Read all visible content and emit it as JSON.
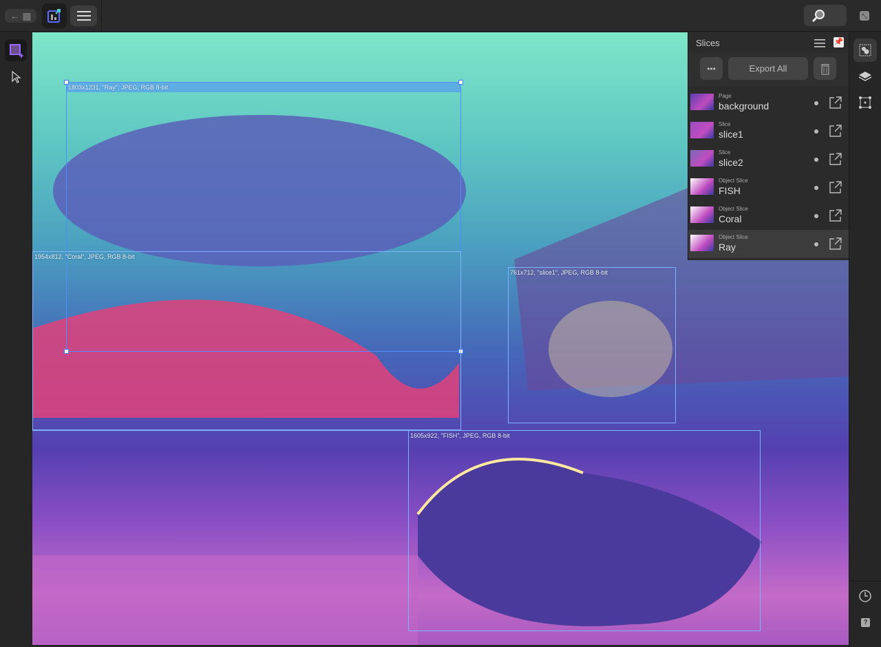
{
  "toolbar": {
    "back_icon": "back-arrow-grid-icon",
    "export_persona_icon": "export-persona-icon",
    "menu_icon": "hamburger-icon",
    "zoom_icon": "magnifier-icon",
    "fullscreen_icon": "fullscreen-icon"
  },
  "left_tools": [
    {
      "icon": "slice-tool-icon",
      "active": true
    },
    {
      "icon": "pointer-icon",
      "active": false
    }
  ],
  "canvas": {
    "slices": [
      {
        "name": "Ray",
        "label": "1803x1231, \"Ray\", JPEG, RGB 8-bit",
        "selected": true
      },
      {
        "name": "Coral",
        "label": "1954x812, \"Coral\", JPEG, RGB 8-bit",
        "selected": false
      },
      {
        "name": "slice1",
        "label": "761x712, \"slice1\", JPEG, RGB 8-bit",
        "selected": false
      },
      {
        "name": "FISH",
        "label": "1605x922, \"FISH\", JPEG, RGB 8-bit",
        "selected": false
      }
    ]
  },
  "slices_panel": {
    "title": "Slices",
    "more_label": "•••",
    "export_all_label": "Export All",
    "items": [
      {
        "type": "Page",
        "name": "background",
        "thumb": "#5a3fb0",
        "active": false
      },
      {
        "type": "Slice",
        "name": "slice1",
        "thumb": "#9c4cc4",
        "active": false
      },
      {
        "type": "Slice",
        "name": "slice2",
        "thumb": "#7a6ab8",
        "active": false
      },
      {
        "type": "Object Slice",
        "name": "FISH",
        "thumb": "#ffffff",
        "active": false
      },
      {
        "type": "Object Slice",
        "name": "Coral",
        "thumb": "#ffffff",
        "active": false
      },
      {
        "type": "Object Slice",
        "name": "Ray",
        "thumb": "#ffffff",
        "active": true
      }
    ]
  },
  "right_tools": [
    "slices-studio-icon",
    "layers-icon",
    "transform-icon",
    "history-icon",
    "help-icon"
  ],
  "right_help_label": "?",
  "colors": {
    "accent": "#4f8cff",
    "panel": "#2b2b2b",
    "background": "#262626"
  }
}
